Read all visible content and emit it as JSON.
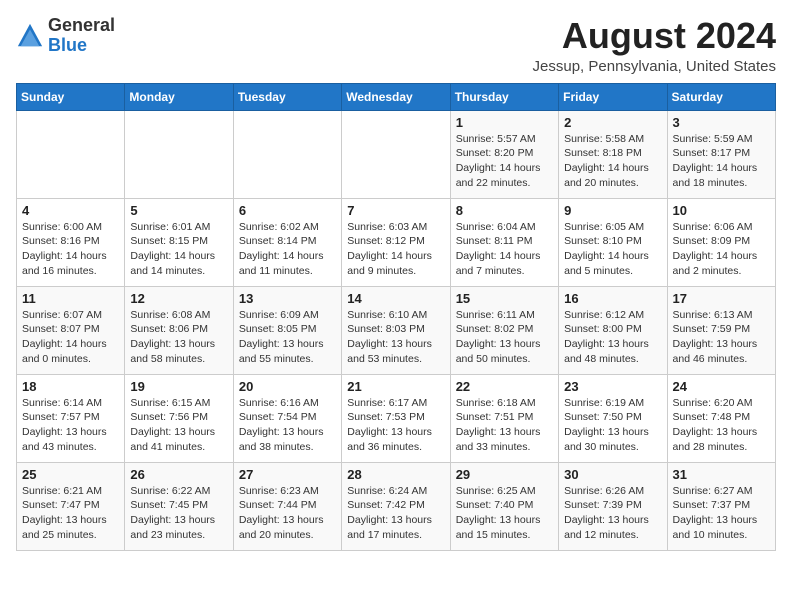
{
  "header": {
    "logo_general": "General",
    "logo_blue": "Blue",
    "month_year": "August 2024",
    "location": "Jessup, Pennsylvania, United States"
  },
  "days_of_week": [
    "Sunday",
    "Monday",
    "Tuesday",
    "Wednesday",
    "Thursday",
    "Friday",
    "Saturday"
  ],
  "weeks": [
    [
      {
        "day": "",
        "info": ""
      },
      {
        "day": "",
        "info": ""
      },
      {
        "day": "",
        "info": ""
      },
      {
        "day": "",
        "info": ""
      },
      {
        "day": "1",
        "info": "Sunrise: 5:57 AM\nSunset: 8:20 PM\nDaylight: 14 hours\nand 22 minutes."
      },
      {
        "day": "2",
        "info": "Sunrise: 5:58 AM\nSunset: 8:18 PM\nDaylight: 14 hours\nand 20 minutes."
      },
      {
        "day": "3",
        "info": "Sunrise: 5:59 AM\nSunset: 8:17 PM\nDaylight: 14 hours\nand 18 minutes."
      }
    ],
    [
      {
        "day": "4",
        "info": "Sunrise: 6:00 AM\nSunset: 8:16 PM\nDaylight: 14 hours\nand 16 minutes."
      },
      {
        "day": "5",
        "info": "Sunrise: 6:01 AM\nSunset: 8:15 PM\nDaylight: 14 hours\nand 14 minutes."
      },
      {
        "day": "6",
        "info": "Sunrise: 6:02 AM\nSunset: 8:14 PM\nDaylight: 14 hours\nand 11 minutes."
      },
      {
        "day": "7",
        "info": "Sunrise: 6:03 AM\nSunset: 8:12 PM\nDaylight: 14 hours\nand 9 minutes."
      },
      {
        "day": "8",
        "info": "Sunrise: 6:04 AM\nSunset: 8:11 PM\nDaylight: 14 hours\nand 7 minutes."
      },
      {
        "day": "9",
        "info": "Sunrise: 6:05 AM\nSunset: 8:10 PM\nDaylight: 14 hours\nand 5 minutes."
      },
      {
        "day": "10",
        "info": "Sunrise: 6:06 AM\nSunset: 8:09 PM\nDaylight: 14 hours\nand 2 minutes."
      }
    ],
    [
      {
        "day": "11",
        "info": "Sunrise: 6:07 AM\nSunset: 8:07 PM\nDaylight: 14 hours\nand 0 minutes."
      },
      {
        "day": "12",
        "info": "Sunrise: 6:08 AM\nSunset: 8:06 PM\nDaylight: 13 hours\nand 58 minutes."
      },
      {
        "day": "13",
        "info": "Sunrise: 6:09 AM\nSunset: 8:05 PM\nDaylight: 13 hours\nand 55 minutes."
      },
      {
        "day": "14",
        "info": "Sunrise: 6:10 AM\nSunset: 8:03 PM\nDaylight: 13 hours\nand 53 minutes."
      },
      {
        "day": "15",
        "info": "Sunrise: 6:11 AM\nSunset: 8:02 PM\nDaylight: 13 hours\nand 50 minutes."
      },
      {
        "day": "16",
        "info": "Sunrise: 6:12 AM\nSunset: 8:00 PM\nDaylight: 13 hours\nand 48 minutes."
      },
      {
        "day": "17",
        "info": "Sunrise: 6:13 AM\nSunset: 7:59 PM\nDaylight: 13 hours\nand 46 minutes."
      }
    ],
    [
      {
        "day": "18",
        "info": "Sunrise: 6:14 AM\nSunset: 7:57 PM\nDaylight: 13 hours\nand 43 minutes."
      },
      {
        "day": "19",
        "info": "Sunrise: 6:15 AM\nSunset: 7:56 PM\nDaylight: 13 hours\nand 41 minutes."
      },
      {
        "day": "20",
        "info": "Sunrise: 6:16 AM\nSunset: 7:54 PM\nDaylight: 13 hours\nand 38 minutes."
      },
      {
        "day": "21",
        "info": "Sunrise: 6:17 AM\nSunset: 7:53 PM\nDaylight: 13 hours\nand 36 minutes."
      },
      {
        "day": "22",
        "info": "Sunrise: 6:18 AM\nSunset: 7:51 PM\nDaylight: 13 hours\nand 33 minutes."
      },
      {
        "day": "23",
        "info": "Sunrise: 6:19 AM\nSunset: 7:50 PM\nDaylight: 13 hours\nand 30 minutes."
      },
      {
        "day": "24",
        "info": "Sunrise: 6:20 AM\nSunset: 7:48 PM\nDaylight: 13 hours\nand 28 minutes."
      }
    ],
    [
      {
        "day": "25",
        "info": "Sunrise: 6:21 AM\nSunset: 7:47 PM\nDaylight: 13 hours\nand 25 minutes."
      },
      {
        "day": "26",
        "info": "Sunrise: 6:22 AM\nSunset: 7:45 PM\nDaylight: 13 hours\nand 23 minutes."
      },
      {
        "day": "27",
        "info": "Sunrise: 6:23 AM\nSunset: 7:44 PM\nDaylight: 13 hours\nand 20 minutes."
      },
      {
        "day": "28",
        "info": "Sunrise: 6:24 AM\nSunset: 7:42 PM\nDaylight: 13 hours\nand 17 minutes."
      },
      {
        "day": "29",
        "info": "Sunrise: 6:25 AM\nSunset: 7:40 PM\nDaylight: 13 hours\nand 15 minutes."
      },
      {
        "day": "30",
        "info": "Sunrise: 6:26 AM\nSunset: 7:39 PM\nDaylight: 13 hours\nand 12 minutes."
      },
      {
        "day": "31",
        "info": "Sunrise: 6:27 AM\nSunset: 7:37 PM\nDaylight: 13 hours\nand 10 minutes."
      }
    ]
  ]
}
